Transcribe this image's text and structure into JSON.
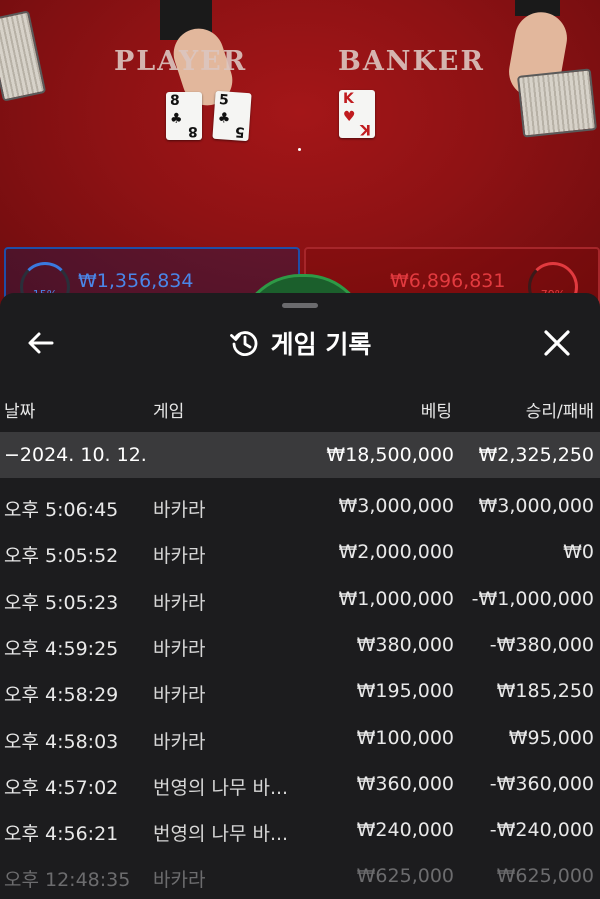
{
  "table": {
    "player_label": "PLAYER",
    "banker_label": "BANKER",
    "player_cards": [
      {
        "rank": "8",
        "suit": "♣",
        "color": "black"
      },
      {
        "rank": "5",
        "suit": "♣",
        "color": "black"
      }
    ],
    "banker_cards": [
      {
        "rank": "K",
        "suit": "♥",
        "color": "red"
      }
    ],
    "player_total_bet": "₩1,356,834",
    "banker_total_bet": "₩6,896,831",
    "player_percent": "15%",
    "banker_percent": "79%",
    "colors": {
      "player": "#4a86e8",
      "banker": "#e23a3f",
      "felt": "#8e1214"
    }
  },
  "sheet": {
    "title": "게임 기록",
    "icons": {
      "back": "arrow-left-icon",
      "history": "history-icon",
      "close": "close-icon"
    },
    "columns": {
      "date": "날짜",
      "game": "게임",
      "bet": "베팅",
      "result": "승리/패배"
    },
    "date_group": {
      "date": "−2024. 10. 12.",
      "bet": "₩18,500,000",
      "result": "₩2,325,250"
    },
    "rows": [
      {
        "time": "오후 5:06:45",
        "game": "바카라",
        "bet": "₩3,000,000",
        "result": "₩3,000,000"
      },
      {
        "time": "오후 5:05:52",
        "game": "바카라",
        "bet": "₩2,000,000",
        "result": "₩0"
      },
      {
        "time": "오후 5:05:23",
        "game": "바카라",
        "bet": "₩1,000,000",
        "result": "-₩1,000,000"
      },
      {
        "time": "오후 4:59:25",
        "game": "바카라",
        "bet": "₩380,000",
        "result": "-₩380,000"
      },
      {
        "time": "오후 4:58:29",
        "game": "바카라",
        "bet": "₩195,000",
        "result": "₩185,250"
      },
      {
        "time": "오후 4:58:03",
        "game": "바카라",
        "bet": "₩100,000",
        "result": "₩95,000"
      },
      {
        "time": "오후 4:57:02",
        "game": "번영의 나무 바...",
        "bet": "₩360,000",
        "result": "-₩360,000"
      },
      {
        "time": "오후 4:56:21",
        "game": "번영의 나무 바...",
        "bet": "₩240,000",
        "result": "-₩240,000"
      },
      {
        "time": "오후 12:48:35",
        "game": "바카라",
        "bet": "₩625,000",
        "result": "₩625,000"
      }
    ]
  }
}
